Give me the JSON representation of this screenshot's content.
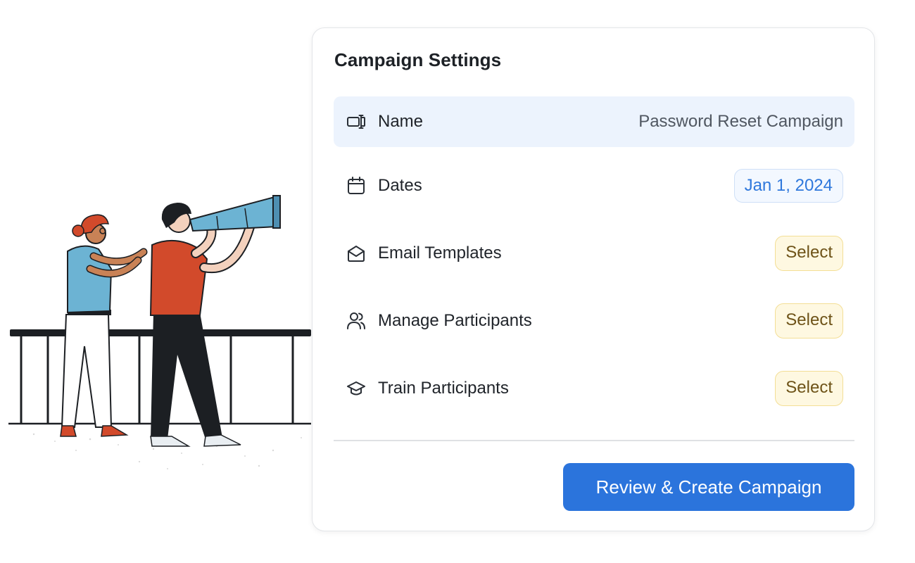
{
  "card": {
    "title": "Campaign Settings",
    "rows": [
      {
        "label": "Name",
        "value": "Password Reset Campaign",
        "icon": "name-field-icon",
        "active": true
      },
      {
        "label": "Dates",
        "value": "Jan 1, 2024",
        "icon": "calendar-icon"
      },
      {
        "label": "Email Templates",
        "value": "Select",
        "icon": "envelope-icon"
      },
      {
        "label": "Manage Participants",
        "value": "Select",
        "icon": "users-icon"
      },
      {
        "label": "Train Participants",
        "value": "Select",
        "icon": "graduation-cap-icon"
      }
    ],
    "cta_label": "Review & Create Campaign"
  },
  "colors": {
    "accent": "#2b74dc",
    "active_row_bg": "#ecf3fd",
    "date_text": "#2f78dc",
    "select_text": "#6e5318",
    "select_bg": "#fef8e1"
  },
  "illustration": {
    "subject": "two-people-with-telescope-illustration"
  }
}
